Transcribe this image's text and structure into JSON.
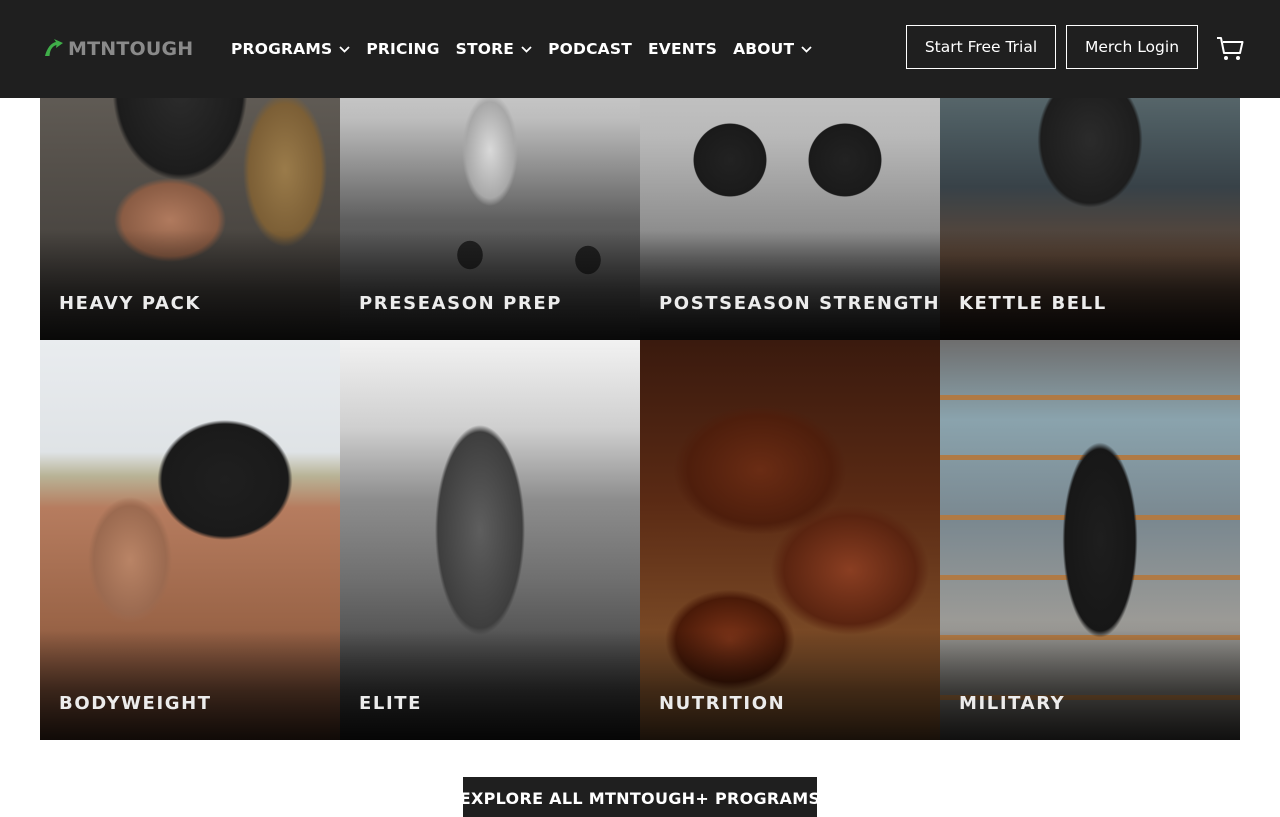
{
  "header": {
    "logo_text": "MTNTOUGH",
    "logo_icon": "mountain-arrow-logo",
    "nav": [
      {
        "label": "PROGRAMS",
        "dropdown": true
      },
      {
        "label": "PRICING",
        "dropdown": false
      },
      {
        "label": "STORE",
        "dropdown": true
      },
      {
        "label": "PODCAST",
        "dropdown": false
      },
      {
        "label": "EVENTS",
        "dropdown": false
      },
      {
        "label": "ABOUT",
        "dropdown": true
      }
    ],
    "trial_button": "Start Free Trial",
    "merch_button": "Merch Login",
    "cart_icon": "cart-icon",
    "colors": {
      "background": "#1f1f1f",
      "text": "#ffffff",
      "logo_green": "#3fae49"
    }
  },
  "programs": [
    {
      "label": "HEAVY PACK"
    },
    {
      "label": "PRESEASON PREP"
    },
    {
      "label": "POSTSEASON STRENGTH"
    },
    {
      "label": "KETTLE BELL"
    },
    {
      "label": "BODYWEIGHT"
    },
    {
      "label": "ELITE"
    },
    {
      "label": "NUTRITION"
    },
    {
      "label": "MILITARY"
    }
  ],
  "cta": {
    "label": "EXPLORE ALL MTNTOUGH+ PROGRAMS"
  }
}
